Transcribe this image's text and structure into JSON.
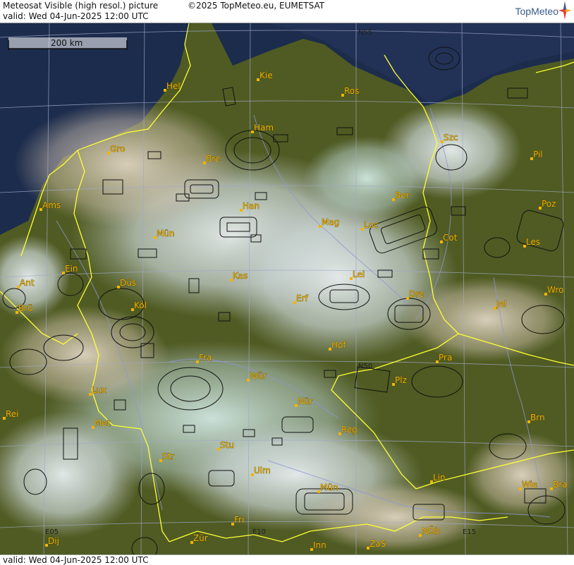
{
  "header": {
    "title": "Meteosat Visible (high resol.) picture",
    "copyright": "©2025 TopMeteo.eu, EUMETSAT",
    "valid": "valid: Wed  04-Jun-2025  12:00 UTC",
    "logo": "TopMeteo"
  },
  "footer": {
    "valid": "valid: Wed  04-Jun-2025  12:00 UTC"
  },
  "scale": {
    "label": "200 km"
  },
  "coordinates": [
    {
      "id": "n55",
      "label": "N55"
    },
    {
      "id": "n50",
      "label": "N50"
    },
    {
      "id": "e05",
      "label": "E05"
    },
    {
      "id": "e10",
      "label": "E10"
    },
    {
      "id": "e15",
      "label": "E15"
    }
  ],
  "cities": [
    {
      "id": "hel",
      "label": "Hel"
    },
    {
      "id": "kie",
      "label": "Kie"
    },
    {
      "id": "ros",
      "label": "Ros"
    },
    {
      "id": "ham",
      "label": "Ham"
    },
    {
      "id": "szc",
      "label": "Szc"
    },
    {
      "id": "gro",
      "label": "Gro"
    },
    {
      "id": "bre",
      "label": "Bre"
    },
    {
      "id": "pil",
      "label": "Pil"
    },
    {
      "id": "ber",
      "label": "Ber"
    },
    {
      "id": "ams",
      "label": "Ams"
    },
    {
      "id": "han",
      "label": "Han"
    },
    {
      "id": "poz",
      "label": "Poz"
    },
    {
      "id": "mag",
      "label": "Mag"
    },
    {
      "id": "loc",
      "label": "Loc"
    },
    {
      "id": "mun-ster",
      "label": "Mün"
    },
    {
      "id": "cot",
      "label": "Cot"
    },
    {
      "id": "les",
      "label": "Les"
    },
    {
      "id": "ein",
      "label": "Ein"
    },
    {
      "id": "kas",
      "label": "Kas"
    },
    {
      "id": "lei",
      "label": "Lei"
    },
    {
      "id": "ant",
      "label": "Ant"
    },
    {
      "id": "dus",
      "label": "Düs"
    },
    {
      "id": "dre",
      "label": "Dre"
    },
    {
      "id": "wro",
      "label": "Wro"
    },
    {
      "id": "bru",
      "label": "Brü"
    },
    {
      "id": "kol",
      "label": "Köl"
    },
    {
      "id": "erf",
      "label": "Erf"
    },
    {
      "id": "jel",
      "label": "Jel"
    },
    {
      "id": "hof",
      "label": "Hof"
    },
    {
      "id": "fra",
      "label": "Fra"
    },
    {
      "id": "pra",
      "label": "Pra"
    },
    {
      "id": "wur",
      "label": "Wür"
    },
    {
      "id": "plz",
      "label": "Plz"
    },
    {
      "id": "lux",
      "label": "Lux"
    },
    {
      "id": "nur",
      "label": "Nür"
    },
    {
      "id": "rei",
      "label": "Rei"
    },
    {
      "id": "brn",
      "label": "Brn"
    },
    {
      "id": "met",
      "label": "Met"
    },
    {
      "id": "reg",
      "label": "Reg"
    },
    {
      "id": "stu",
      "label": "Stu"
    },
    {
      "id": "str",
      "label": "Str"
    },
    {
      "id": "lin",
      "label": "Lin"
    },
    {
      "id": "ulm",
      "label": "Ulm"
    },
    {
      "id": "mun-chen",
      "label": "Mün"
    },
    {
      "id": "wie",
      "label": "Wie"
    },
    {
      "id": "bra",
      "label": "Bra"
    },
    {
      "id": "fri",
      "label": "Fri"
    },
    {
      "id": "dij",
      "label": "Dij"
    },
    {
      "id": "zur",
      "label": "Zür"
    },
    {
      "id": "nob",
      "label": "NÖb"
    },
    {
      "id": "inn",
      "label": "Inn"
    },
    {
      "id": "zas",
      "label": "ZaS"
    }
  ],
  "colors": {
    "border": "#ffff33",
    "grid": "#a0a8c8",
    "city_label": "#f2b400",
    "sea": "#1a2a4a",
    "land": "#4e5a22"
  }
}
